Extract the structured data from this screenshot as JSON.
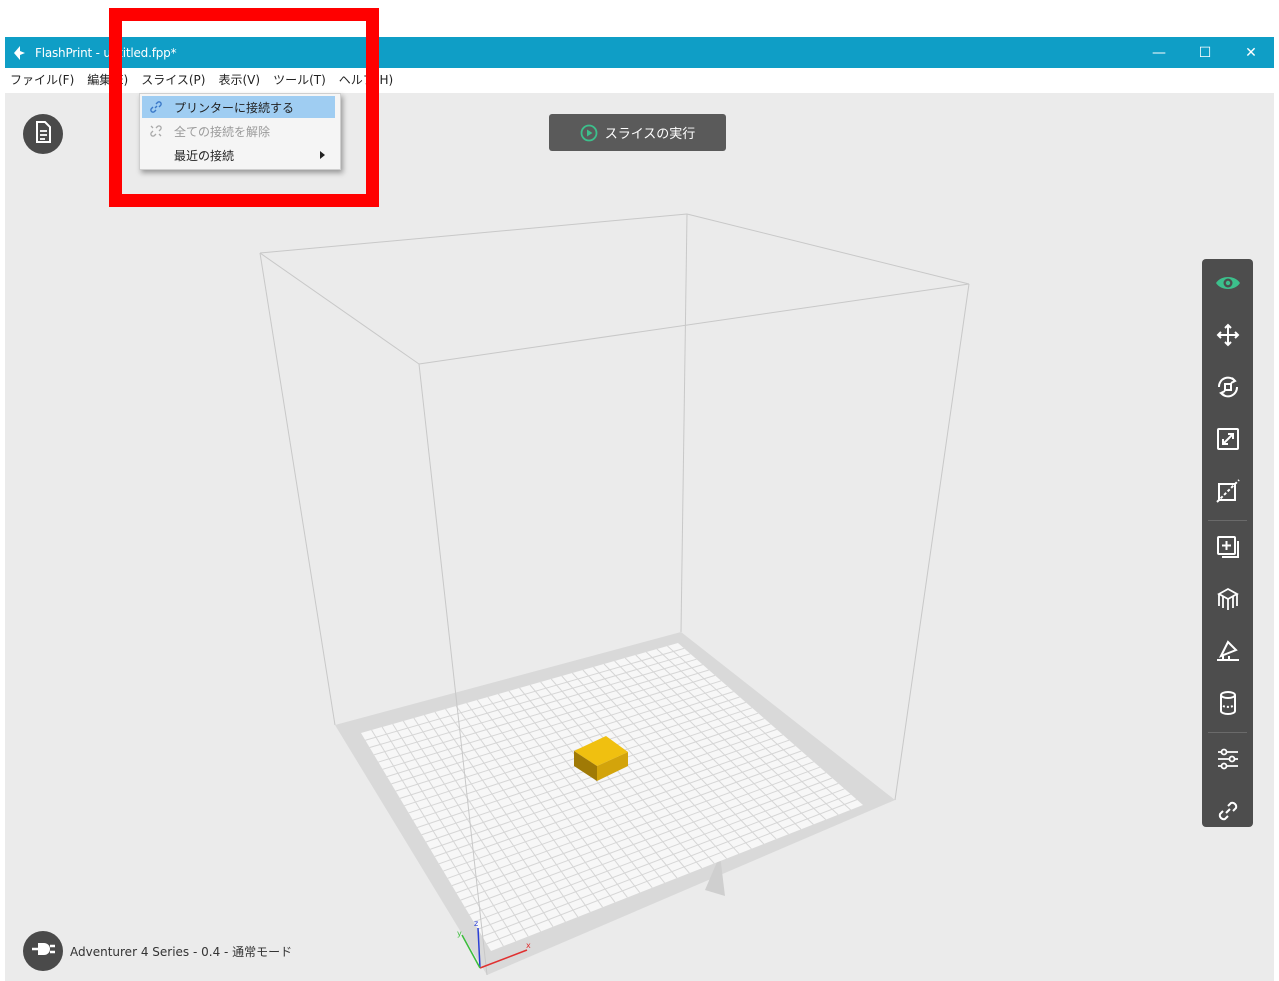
{
  "window": {
    "title": "FlashPrint - untitled.fpp*",
    "controls": {
      "minimize": "—",
      "maximize": "☐",
      "close": "✕"
    }
  },
  "menubar": {
    "items": [
      "ファイル(F)",
      "編集(E)",
      "スライス(P)",
      "表示(V)",
      "ツール(T)",
      "ヘルプ(H)"
    ]
  },
  "slice_menu": {
    "items": [
      {
        "label": "プリンターに接続する",
        "state": "selected",
        "icon": "link-icon"
      },
      {
        "label": "全ての接続を解除",
        "state": "disabled",
        "icon": "unlink-icon"
      },
      {
        "label": "最近の接続",
        "state": "normal",
        "has_submenu": true
      }
    ]
  },
  "viewport": {
    "slice_button_label": "スライスの実行",
    "status_printer": "Adventurer 4 Series - 0.4 - 通常モード",
    "axes": {
      "z": "z",
      "x": "x",
      "y": "y"
    }
  },
  "toolbar": {
    "tools": [
      "view-icon",
      "move-icon",
      "rotate-icon",
      "scale-icon",
      "cut-icon",
      "extruder-icon",
      "supports-icon",
      "measure-icon",
      "cylinder-icon",
      "settings-icon",
      "connect-icon"
    ]
  },
  "colors": {
    "titlebar": "#0f9ec6",
    "accent_green": "#3cc08c",
    "highlight_box": "#ff0000",
    "model": "#e3b10e"
  }
}
